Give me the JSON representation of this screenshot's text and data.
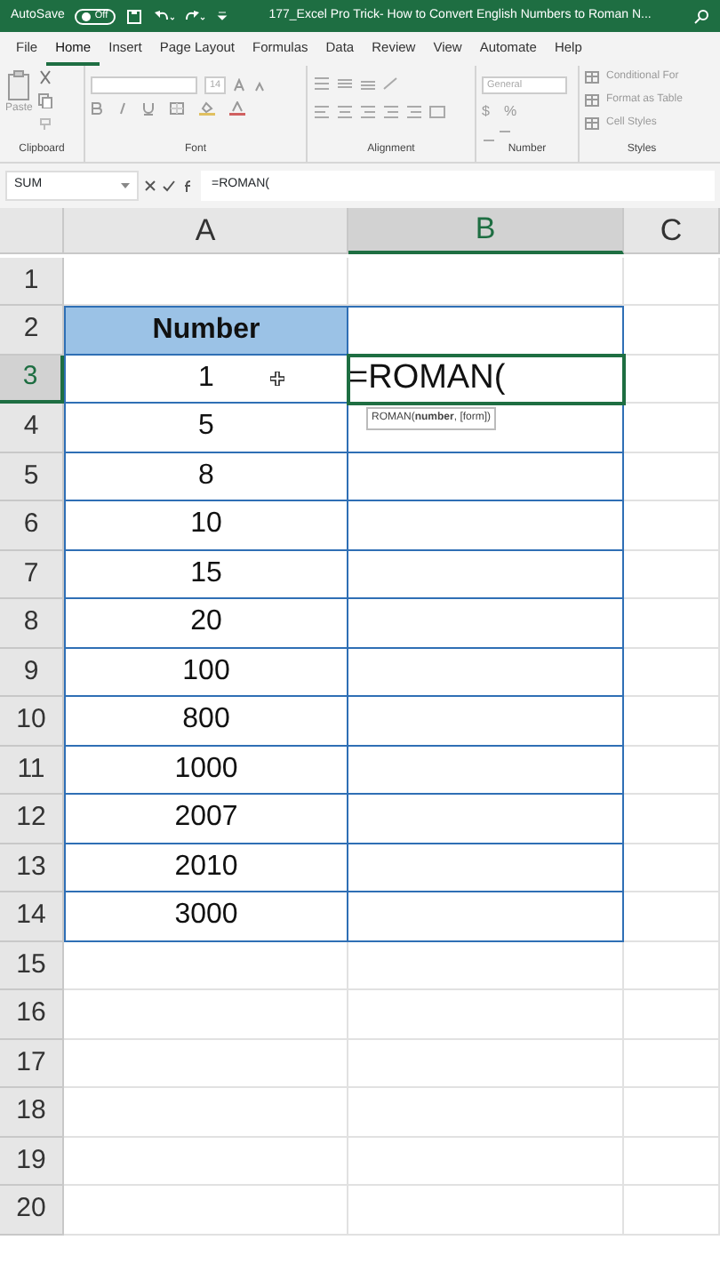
{
  "title_bar": {
    "autosave_label": "AutoSave",
    "autosave_toggle": {
      "label": "Off",
      "on": false
    },
    "title": "177_Excel Pro Trick- How to Convert English Numbers to Roman N..."
  },
  "menu_tabs": [
    {
      "label": "File",
      "selected": false
    },
    {
      "label": "Home",
      "selected": true
    },
    {
      "label": "Insert",
      "selected": false
    },
    {
      "label": "Page Layout",
      "selected": false
    },
    {
      "label": "Formulas",
      "selected": false
    },
    {
      "label": "Data",
      "selected": false
    },
    {
      "label": "Review",
      "selected": false
    },
    {
      "label": "View",
      "selected": false
    },
    {
      "label": "Automate",
      "selected": false
    },
    {
      "label": "Help",
      "selected": false
    }
  ],
  "ribbon": {
    "paste_label": "Paste",
    "font_size": "14",
    "number_format": "General",
    "currency": "$",
    "percent": "%",
    "styles_items": [
      "Conditional For",
      "Format as Table",
      "Cell Styles"
    ],
    "group_labels": [
      "Clipboard",
      "Font",
      "Alignment",
      "Number",
      "Styles"
    ]
  },
  "formula_bar": {
    "name_box": "SUM",
    "formula": "=ROMAN("
  },
  "columns": [
    {
      "label": "A",
      "selected": false
    },
    {
      "label": "B",
      "selected": true
    },
    {
      "label": "C",
      "selected": false
    }
  ],
  "rows": [
    {
      "number": "1",
      "selected": false,
      "boxed": false
    },
    {
      "number": "2",
      "selected": false,
      "boxed": true,
      "a": {
        "text": "Number",
        "kind": "header"
      }
    },
    {
      "number": "3",
      "selected": true,
      "boxed": true,
      "a": {
        "text": "1",
        "kind": "value"
      },
      "b": {
        "text": "=ROMAN(",
        "kind": "editing",
        "tooltip": "ROMAN(**number**, [form])"
      }
    },
    {
      "number": "4",
      "selected": false,
      "boxed": true,
      "a": {
        "text": "5",
        "kind": "value"
      }
    },
    {
      "number": "5",
      "selected": false,
      "boxed": true,
      "a": {
        "text": "8",
        "kind": "value"
      }
    },
    {
      "number": "6",
      "selected": false,
      "boxed": true,
      "a": {
        "text": "10",
        "kind": "value"
      }
    },
    {
      "number": "7",
      "selected": false,
      "boxed": true,
      "a": {
        "text": "15",
        "kind": "value"
      }
    },
    {
      "number": "8",
      "selected": false,
      "boxed": true,
      "a": {
        "text": "20",
        "kind": "value"
      }
    },
    {
      "number": "9",
      "selected": false,
      "boxed": true,
      "a": {
        "text": "100",
        "kind": "value"
      }
    },
    {
      "number": "10",
      "selected": false,
      "boxed": true,
      "a": {
        "text": "800",
        "kind": "value"
      }
    },
    {
      "number": "11",
      "selected": false,
      "boxed": true,
      "a": {
        "text": "1000",
        "kind": "value"
      }
    },
    {
      "number": "12",
      "selected": false,
      "boxed": true,
      "a": {
        "text": "2007",
        "kind": "value"
      }
    },
    {
      "number": "13",
      "selected": false,
      "boxed": true,
      "a": {
        "text": "2010",
        "kind": "value"
      }
    },
    {
      "number": "14",
      "selected": false,
      "boxed": true,
      "a": {
        "text": "3000",
        "kind": "value"
      }
    },
    {
      "number": "15",
      "selected": false,
      "boxed": false
    },
    {
      "number": "16",
      "selected": false,
      "boxed": false
    },
    {
      "number": "17",
      "selected": false,
      "boxed": false
    },
    {
      "number": "18",
      "selected": false,
      "boxed": false
    },
    {
      "number": "19",
      "selected": false,
      "boxed": false
    },
    {
      "number": "20",
      "selected": false,
      "boxed": false
    }
  ]
}
